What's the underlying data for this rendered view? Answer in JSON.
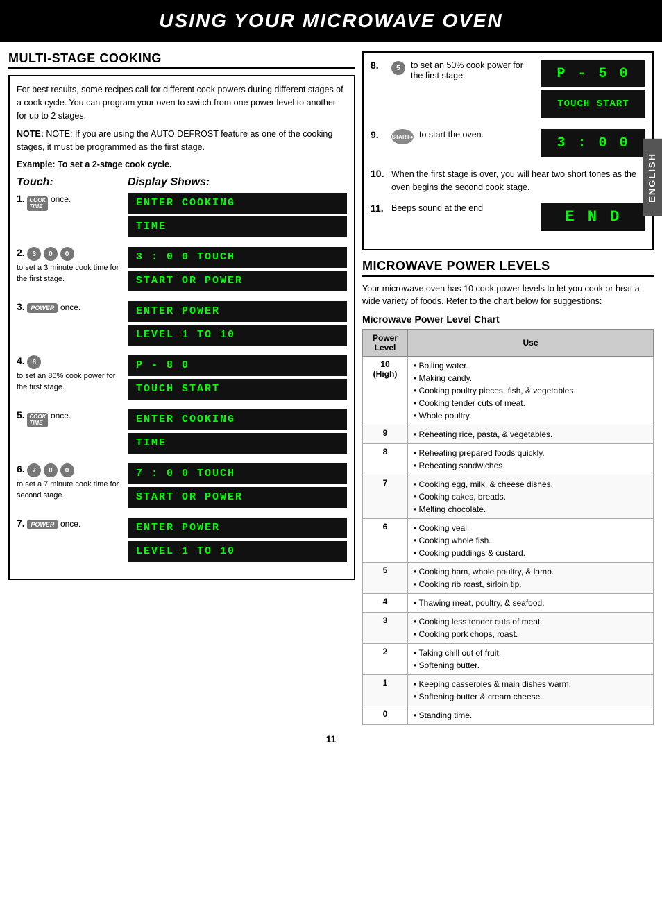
{
  "header": {
    "title": "USING YOUR MICROWAVE OVEN"
  },
  "section_multi_stage": {
    "title": "MULTI-STAGE COOKING",
    "intro": "For best results, some recipes call for different cook powers during different stages of a cook cycle. You can program your oven to switch from one power level to another for up to 2 stages.",
    "note": "NOTE: If you are using the AUTO DEFROST feature as one of the cooking stages, it must be programmed as the first stage.",
    "example": "Example: To set a 2-stage cook cycle.",
    "touch_header": "Touch:",
    "display_header": "Display Shows:",
    "steps": [
      {
        "num": "1.",
        "icon_label": "COOK TIME",
        "action": "once.",
        "displays": [
          "ENTER COOKING",
          "TIME"
        ]
      },
      {
        "num": "2.",
        "icons": [
          "3",
          "0",
          "0"
        ],
        "sub_text": "to set a 3 minute cook time for the first stage.",
        "displays": [
          "3 : 0 0 TOUCH",
          "START OR POWER"
        ]
      },
      {
        "num": "3.",
        "icon_label": "POWER",
        "action": "once.",
        "displays": [
          "ENTER POWER",
          "LEVEL 1 TO 10"
        ]
      },
      {
        "num": "4.",
        "icon_label": "8",
        "sub_text": "to set an 80% cook power for the first stage.",
        "displays": [
          "P - 8 0",
          "TOUCH START"
        ]
      },
      {
        "num": "5.",
        "icon_label": "COOK TIME",
        "action": "once.",
        "displays": [
          "ENTER COOKING",
          "TIME"
        ]
      },
      {
        "num": "6.",
        "icons": [
          "7",
          "0",
          "0"
        ],
        "sub_text": "to set a 7 minute cook time for second stage.",
        "displays": [
          "7 : 0 0 TOUCH",
          "START OR POWER"
        ]
      },
      {
        "num": "7.",
        "icon_label": "POWER",
        "action": "once.",
        "displays": [
          "ENTER POWER",
          "LEVEL 1 TO 10"
        ]
      }
    ]
  },
  "right_steps": [
    {
      "num": "8.",
      "icon": "5",
      "text": "to set an 50% cook power for the first stage.",
      "displays": [
        "P - 5 0",
        "TOUCH START"
      ]
    },
    {
      "num": "9.",
      "icon": "START",
      "text": "to start the oven.",
      "displays": [
        "3 : 0 0"
      ]
    },
    {
      "num": "10.",
      "text": "When the first stage is over, you will hear two short tones as the oven begins the second cook stage.",
      "displays": []
    },
    {
      "num": "11.",
      "text": "Beeps sound at the end",
      "displays": [
        "E N D"
      ]
    }
  ],
  "power_levels_section": {
    "title": "MICROWAVE POWER LEVELS",
    "intro": "Your microwave oven has 10 cook power levels to let you cook or heat a wide variety of foods. Refer to the chart below for suggestions:",
    "chart_title": "Microwave Power Level Chart",
    "table_headers": [
      "Power Level",
      "Use"
    ],
    "rows": [
      {
        "level": "10\n(High)",
        "uses": [
          "• Boiling water.",
          "• Making candy.",
          "• Cooking poultry pieces, fish, & vegetables.",
          "• Cooking tender cuts of meat.",
          "• Whole poultry."
        ]
      },
      {
        "level": "9",
        "uses": [
          "• Reheating rice, pasta, & vegetables."
        ]
      },
      {
        "level": "8",
        "uses": [
          "• Reheating prepared foods quickly.",
          "• Reheating sandwiches."
        ]
      },
      {
        "level": "7",
        "uses": [
          "• Cooking egg, milk, & cheese dishes.",
          "• Cooking cakes, breads.",
          "• Melting chocolate."
        ]
      },
      {
        "level": "6",
        "uses": [
          "• Cooking veal.",
          "• Cooking whole fish.",
          "• Cooking puddings & custard."
        ]
      },
      {
        "level": "5",
        "uses": [
          "• Cooking ham, whole poultry, & lamb.",
          "• Cooking rib roast, sirloin tip."
        ]
      },
      {
        "level": "4",
        "uses": [
          "• Thawing meat, poultry, & seafood."
        ]
      },
      {
        "level": "3",
        "uses": [
          "• Cooking less tender cuts of meat.",
          "• Cooking pork chops, roast."
        ]
      },
      {
        "level": "2",
        "uses": [
          "• Taking chill out of fruit.",
          "• Softening butter."
        ]
      },
      {
        "level": "1",
        "uses": [
          "• Keeping casseroles & main dishes warm.",
          "• Softening butter & cream cheese."
        ]
      },
      {
        "level": "0",
        "uses": [
          "• Standing time."
        ]
      }
    ]
  },
  "english_label": "ENGLISH",
  "page_number": "11"
}
